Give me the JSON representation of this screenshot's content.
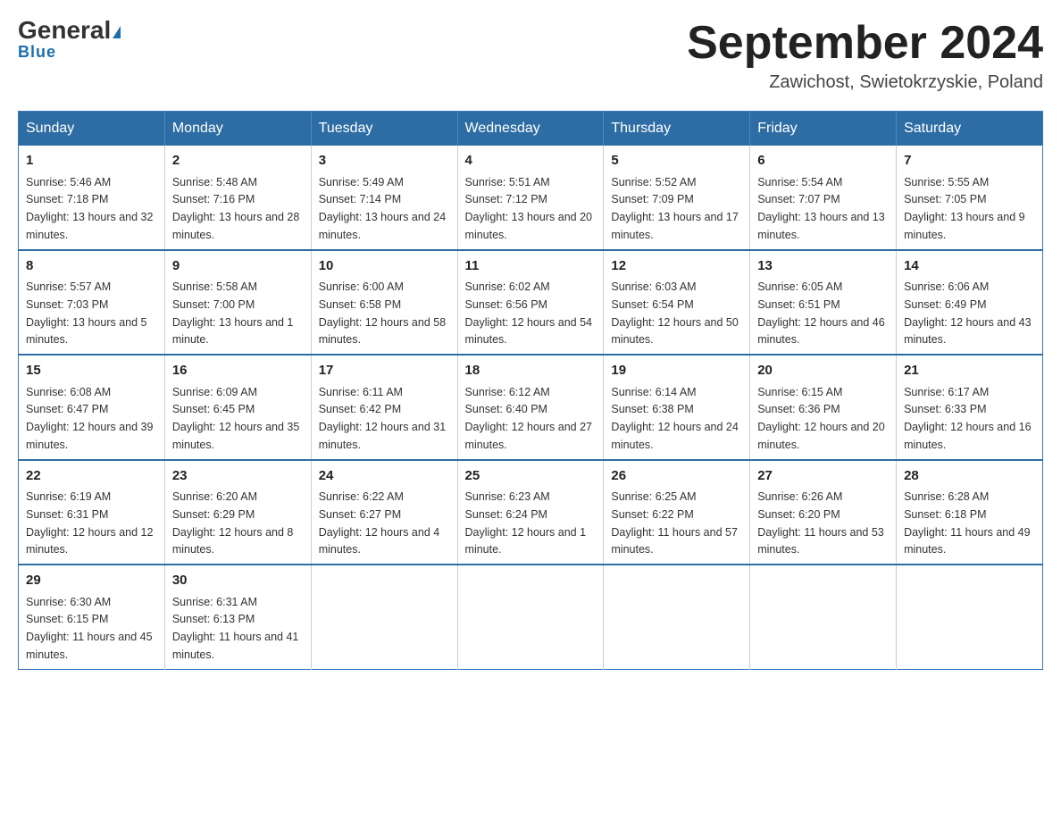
{
  "header": {
    "logo_general": "General",
    "logo_blue": "Blue",
    "month_title": "September 2024",
    "location": "Zawichost, Swietokrzyskie, Poland"
  },
  "weekdays": [
    "Sunday",
    "Monday",
    "Tuesday",
    "Wednesday",
    "Thursday",
    "Friday",
    "Saturday"
  ],
  "weeks": [
    [
      {
        "day": "1",
        "sunrise": "5:46 AM",
        "sunset": "7:18 PM",
        "daylight": "13 hours and 32 minutes."
      },
      {
        "day": "2",
        "sunrise": "5:48 AM",
        "sunset": "7:16 PM",
        "daylight": "13 hours and 28 minutes."
      },
      {
        "day": "3",
        "sunrise": "5:49 AM",
        "sunset": "7:14 PM",
        "daylight": "13 hours and 24 minutes."
      },
      {
        "day": "4",
        "sunrise": "5:51 AM",
        "sunset": "7:12 PM",
        "daylight": "13 hours and 20 minutes."
      },
      {
        "day": "5",
        "sunrise": "5:52 AM",
        "sunset": "7:09 PM",
        "daylight": "13 hours and 17 minutes."
      },
      {
        "day": "6",
        "sunrise": "5:54 AM",
        "sunset": "7:07 PM",
        "daylight": "13 hours and 13 minutes."
      },
      {
        "day": "7",
        "sunrise": "5:55 AM",
        "sunset": "7:05 PM",
        "daylight": "13 hours and 9 minutes."
      }
    ],
    [
      {
        "day": "8",
        "sunrise": "5:57 AM",
        "sunset": "7:03 PM",
        "daylight": "13 hours and 5 minutes."
      },
      {
        "day": "9",
        "sunrise": "5:58 AM",
        "sunset": "7:00 PM",
        "daylight": "13 hours and 1 minute."
      },
      {
        "day": "10",
        "sunrise": "6:00 AM",
        "sunset": "6:58 PM",
        "daylight": "12 hours and 58 minutes."
      },
      {
        "day": "11",
        "sunrise": "6:02 AM",
        "sunset": "6:56 PM",
        "daylight": "12 hours and 54 minutes."
      },
      {
        "day": "12",
        "sunrise": "6:03 AM",
        "sunset": "6:54 PM",
        "daylight": "12 hours and 50 minutes."
      },
      {
        "day": "13",
        "sunrise": "6:05 AM",
        "sunset": "6:51 PM",
        "daylight": "12 hours and 46 minutes."
      },
      {
        "day": "14",
        "sunrise": "6:06 AM",
        "sunset": "6:49 PM",
        "daylight": "12 hours and 43 minutes."
      }
    ],
    [
      {
        "day": "15",
        "sunrise": "6:08 AM",
        "sunset": "6:47 PM",
        "daylight": "12 hours and 39 minutes."
      },
      {
        "day": "16",
        "sunrise": "6:09 AM",
        "sunset": "6:45 PM",
        "daylight": "12 hours and 35 minutes."
      },
      {
        "day": "17",
        "sunrise": "6:11 AM",
        "sunset": "6:42 PM",
        "daylight": "12 hours and 31 minutes."
      },
      {
        "day": "18",
        "sunrise": "6:12 AM",
        "sunset": "6:40 PM",
        "daylight": "12 hours and 27 minutes."
      },
      {
        "day": "19",
        "sunrise": "6:14 AM",
        "sunset": "6:38 PM",
        "daylight": "12 hours and 24 minutes."
      },
      {
        "day": "20",
        "sunrise": "6:15 AM",
        "sunset": "6:36 PM",
        "daylight": "12 hours and 20 minutes."
      },
      {
        "day": "21",
        "sunrise": "6:17 AM",
        "sunset": "6:33 PM",
        "daylight": "12 hours and 16 minutes."
      }
    ],
    [
      {
        "day": "22",
        "sunrise": "6:19 AM",
        "sunset": "6:31 PM",
        "daylight": "12 hours and 12 minutes."
      },
      {
        "day": "23",
        "sunrise": "6:20 AM",
        "sunset": "6:29 PM",
        "daylight": "12 hours and 8 minutes."
      },
      {
        "day": "24",
        "sunrise": "6:22 AM",
        "sunset": "6:27 PM",
        "daylight": "12 hours and 4 minutes."
      },
      {
        "day": "25",
        "sunrise": "6:23 AM",
        "sunset": "6:24 PM",
        "daylight": "12 hours and 1 minute."
      },
      {
        "day": "26",
        "sunrise": "6:25 AM",
        "sunset": "6:22 PM",
        "daylight": "11 hours and 57 minutes."
      },
      {
        "day": "27",
        "sunrise": "6:26 AM",
        "sunset": "6:20 PM",
        "daylight": "11 hours and 53 minutes."
      },
      {
        "day": "28",
        "sunrise": "6:28 AM",
        "sunset": "6:18 PM",
        "daylight": "11 hours and 49 minutes."
      }
    ],
    [
      {
        "day": "29",
        "sunrise": "6:30 AM",
        "sunset": "6:15 PM",
        "daylight": "11 hours and 45 minutes."
      },
      {
        "day": "30",
        "sunrise": "6:31 AM",
        "sunset": "6:13 PM",
        "daylight": "11 hours and 41 minutes."
      },
      null,
      null,
      null,
      null,
      null
    ]
  ]
}
